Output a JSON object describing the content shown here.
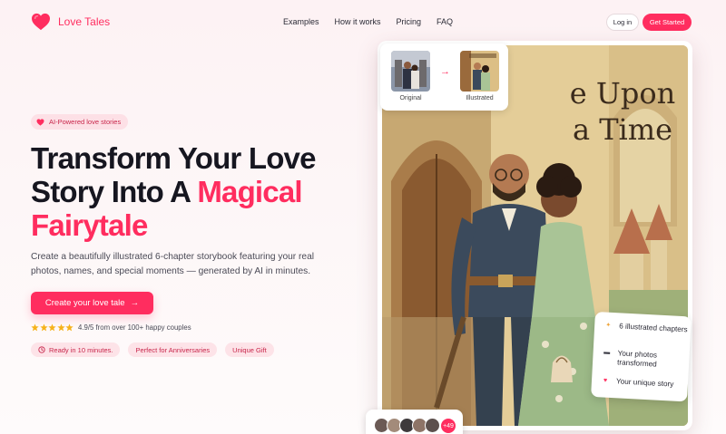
{
  "brand": {
    "name": "Love Tales",
    "accent": "#ff2d5f"
  },
  "nav": {
    "links": [
      "Examples",
      "How it works",
      "Pricing",
      "FAQ"
    ],
    "login_label": "Log in",
    "get_started_label": "Get Started"
  },
  "hero": {
    "badge": "AI-Powered love stories",
    "title_line1": "Transform Your Love",
    "title_line2_plain": "Story Into A ",
    "title_line2_accent": "Magical",
    "title_line3_accent": "Fairytale",
    "description": "Create a beautifully illustrated 6-chapter storybook featuring your real photos, names, and special moments — generated by AI in minutes.",
    "cta_label": "Create your love tale",
    "rating": {
      "stars": 5,
      "text": "4.9/5 from over 100+ happy couples"
    },
    "pills": [
      "Ready in 10 minutes.",
      "Perfect for Anniversaries",
      "Unique Gift"
    ]
  },
  "showcase": {
    "book_title_line1": "e Upon",
    "book_title_line2": "a Time",
    "compare": {
      "original_label": "Original",
      "illustrated_label": "Illustrated"
    },
    "features": [
      {
        "icon": "sparkle-icon",
        "label": "6 illustrated chapters"
      },
      {
        "icon": "camera-icon",
        "label": "Your photos transformed"
      },
      {
        "icon": "heart-icon",
        "label": "Your unique story"
      }
    ],
    "avatars_more": "+49"
  }
}
